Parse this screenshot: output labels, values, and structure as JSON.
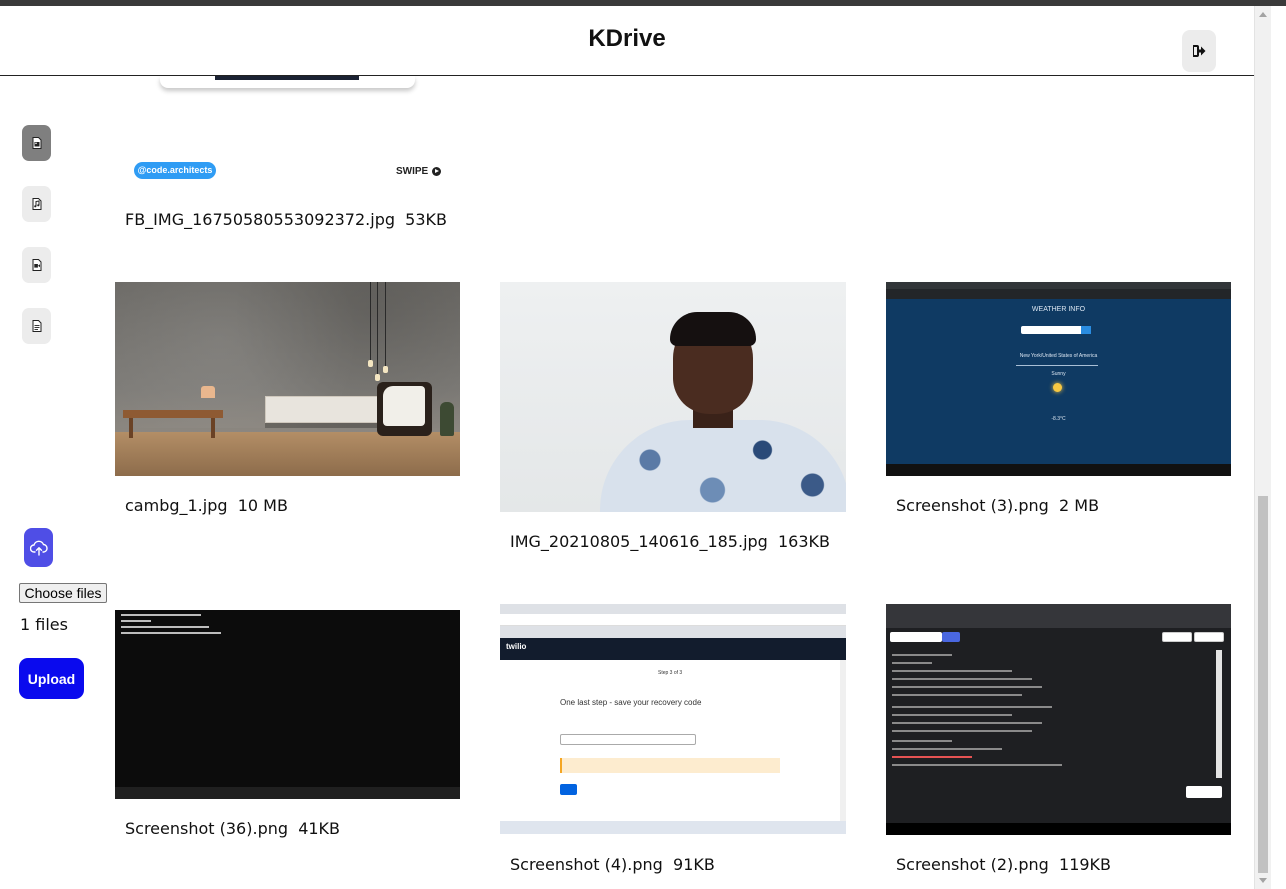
{
  "header": {
    "title": "KDrive",
    "logout_icon": "logout-icon"
  },
  "sidebar": {
    "items": [
      {
        "name": "images",
        "icon": "image-icon",
        "active": true
      },
      {
        "name": "audio",
        "icon": "music-file-icon",
        "active": false
      },
      {
        "name": "video",
        "icon": "video-file-icon",
        "active": false
      },
      {
        "name": "documents",
        "icon": "document-icon",
        "active": false
      }
    ]
  },
  "uploader": {
    "cloud_icon": "cloud-upload-icon",
    "choose_label": "Choose files",
    "files_count": "1 files",
    "upload_label": "Upload"
  },
  "partial_card": {
    "tag": "@code.architects",
    "swipe": "SWIPE"
  },
  "files": [
    {
      "name": "FB_IMG_16750580553092372.jpg",
      "size": "53KB"
    },
    {
      "name": "cambg_1.jpg",
      "size": "10 MB"
    },
    {
      "name": "IMG_20210805_140616_185.jpg",
      "size": "163KB"
    },
    {
      "name": "Screenshot (3).png",
      "size": "2 MB"
    },
    {
      "name": "Screenshot (36).png",
      "size": "41KB"
    },
    {
      "name": "Screenshot (4).png",
      "size": "91KB"
    },
    {
      "name": "Screenshot (2).png",
      "size": "119KB"
    }
  ],
  "weather_shot": {
    "heading": "WEATHER INFO",
    "location": "New York/United States of America",
    "condition": "Sunny",
    "temperature": "-8.3°C"
  },
  "twilio_shot": {
    "brand": "twilio",
    "step": "Step 3 of 3",
    "heading": "One last step - save your recovery code"
  },
  "colors": {
    "accent": "#0a0aee",
    "cloud_button": "#4f4ee6",
    "active_sidebar": "#7f7f7f"
  }
}
